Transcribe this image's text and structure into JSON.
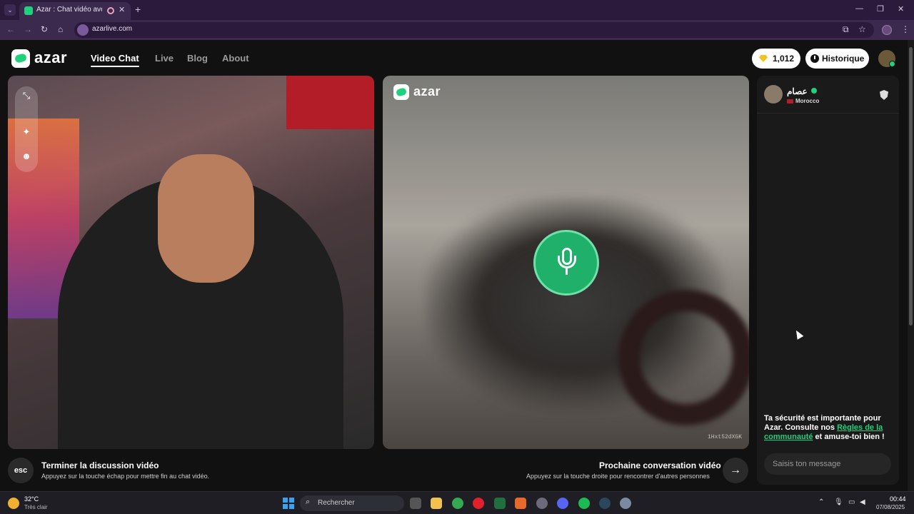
{
  "browser": {
    "tab_title": "Azar : Chat vidéo avec de n",
    "url": "azarlive.com"
  },
  "header": {
    "logo": "azar",
    "nav": [
      "Video Chat",
      "Live",
      "Blog",
      "About"
    ],
    "gems": "1,012",
    "history_label": "Historique"
  },
  "left_video": {
    "tools": [
      "minimize-icon",
      "sparkle-effects-icon",
      "face-filter-icon"
    ]
  },
  "right_video": {
    "logo": "azar",
    "id": "1Hxt52dXGK"
  },
  "controls": {
    "esc_key": "esc",
    "end_title": "Terminer la discussion vidéo",
    "end_sub": "Appuyez sur la touche échap pour mettre fin au chat vidéo.",
    "next_title": "Prochaine conversation vidéo",
    "next_sub": "Appuyez sur la touche droite pour rencontrer d'autres personnes",
    "next_key": "→"
  },
  "chat": {
    "partner_name": "عصام",
    "country": "Morocco",
    "safety_prefix": "Ta sécurité est importante pour Azar. Consulte nos ",
    "safety_link": "Règles de la communauté",
    "safety_suffix": " et amuse-toi bien !",
    "input_placeholder": "Saisis ton message"
  },
  "taskbar": {
    "temperature": "32°C",
    "weather": "Très clair",
    "search_placeholder": "Rechercher",
    "time": "00:44",
    "date": "07/08/2025"
  },
  "colors": {
    "brand_green": "#1fd07c",
    "browser_purple": "#3b2a4e",
    "page_bg": "#111111"
  }
}
